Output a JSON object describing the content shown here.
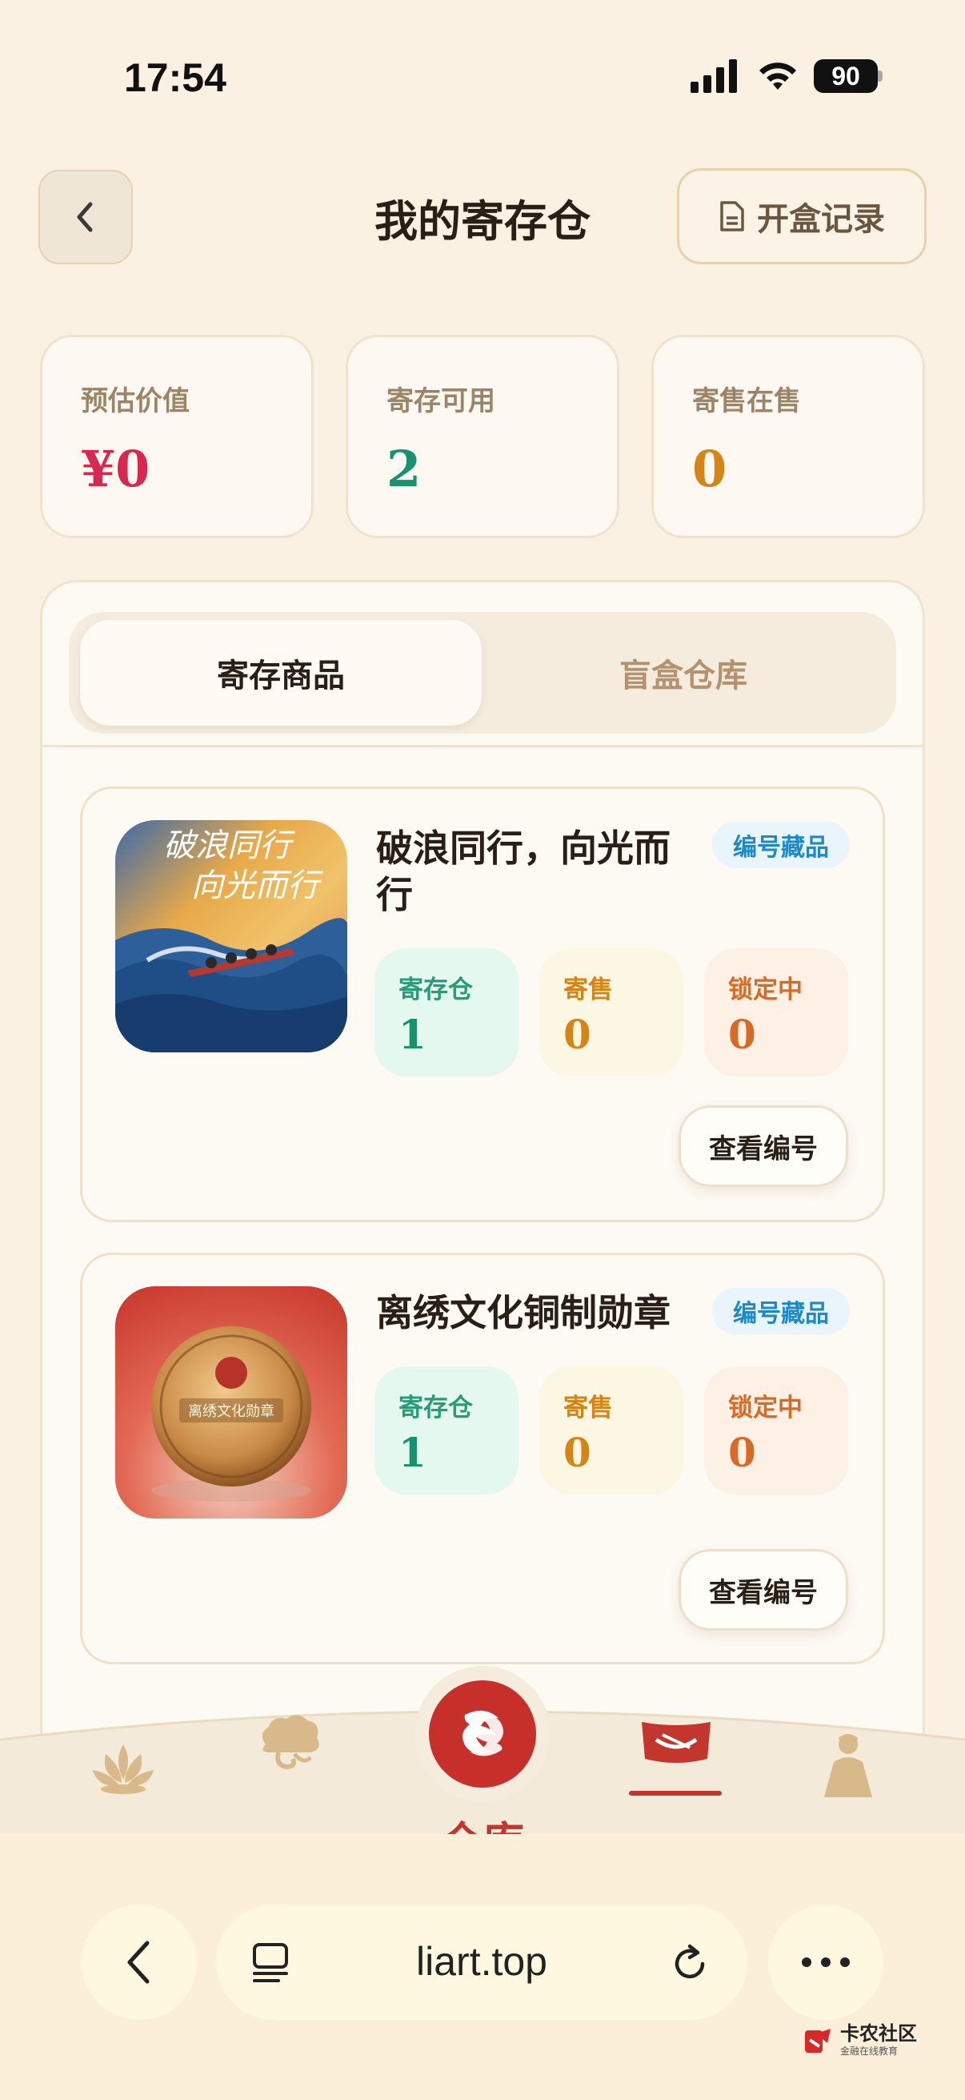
{
  "status_bar": {
    "time": "17:54",
    "battery": "90"
  },
  "header": {
    "title": "我的寄存仓",
    "history_label": "开盒记录"
  },
  "stats": [
    {
      "label": "预估价值",
      "value": "¥0",
      "color": "#d8284f"
    },
    {
      "label": "寄存可用",
      "value": "2",
      "color": "#17926f"
    },
    {
      "label": "寄售在售",
      "value": "0",
      "color": "#d58418"
    }
  ],
  "tabs": [
    {
      "label": "寄存商品",
      "active": true
    },
    {
      "label": "盲盒仓库",
      "active": false
    }
  ],
  "items": [
    {
      "name_line1": "破浪同行，向光而",
      "name_line2": "行",
      "badge": "编号藏品",
      "metrics": [
        {
          "label": "寄存仓",
          "value": "1"
        },
        {
          "label": "寄售",
          "value": "0"
        },
        {
          "label": "锁定中",
          "value": "0"
        }
      ],
      "action": "查看编号",
      "image_text": "破浪同行 向光而行"
    },
    {
      "name_line1": "离绣文化铜制勋章",
      "name_line2": "",
      "badge": "编号藏品",
      "metrics": [
        {
          "label": "寄存仓",
          "value": "1"
        },
        {
          "label": "寄售",
          "value": "0"
        },
        {
          "label": "锁定中",
          "value": "0"
        }
      ],
      "action": "查看编号",
      "image_text": "离绣文化勋章"
    }
  ],
  "bottom_nav": {
    "active_label": "仓库",
    "icons": [
      "lotus-icon",
      "cloud-icon",
      "dragon-logo-icon",
      "flag-icon",
      "figure-icon"
    ]
  },
  "browser": {
    "url": "liart.top"
  },
  "watermark": {
    "title": "卡农社区",
    "subtitle": "金融在线教育"
  },
  "colors": {
    "accent": "#c2362e",
    "background": "#fbf1e2"
  }
}
